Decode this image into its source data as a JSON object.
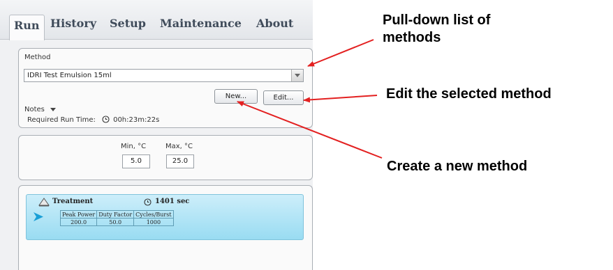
{
  "tabs": [
    "Run",
    "History",
    "Setup",
    "Maintenance",
    "About"
  ],
  "method_panel": {
    "label": "Method",
    "selected_method": "IDRI Test Emulsion 15ml",
    "new_button": "New...",
    "edit_button": "Edit...",
    "notes_label": "Notes",
    "runtime_label": "Required Run Time:",
    "runtime_value": "00h:23m:22s"
  },
  "temperature_panel": {
    "min_label": "Min, °C",
    "max_label": "Max, °C",
    "min_value": "5.0",
    "max_value": "25.0"
  },
  "treatment": {
    "title": "Treatment",
    "duration": "1401 sec",
    "headers": [
      "Peak Power",
      "Duty Factor",
      "Cycles/Burst"
    ],
    "values": [
      "200.0",
      "50.0",
      "1000"
    ]
  },
  "callouts": {
    "pulldown": [
      "Pull-down list of",
      "methods"
    ],
    "edit": "Edit the selected method",
    "create": "Create a new method"
  },
  "colors": {
    "arrow": "#e32020",
    "step_highlight": "#99dcf2",
    "step_marker": "#1a9fd6"
  }
}
